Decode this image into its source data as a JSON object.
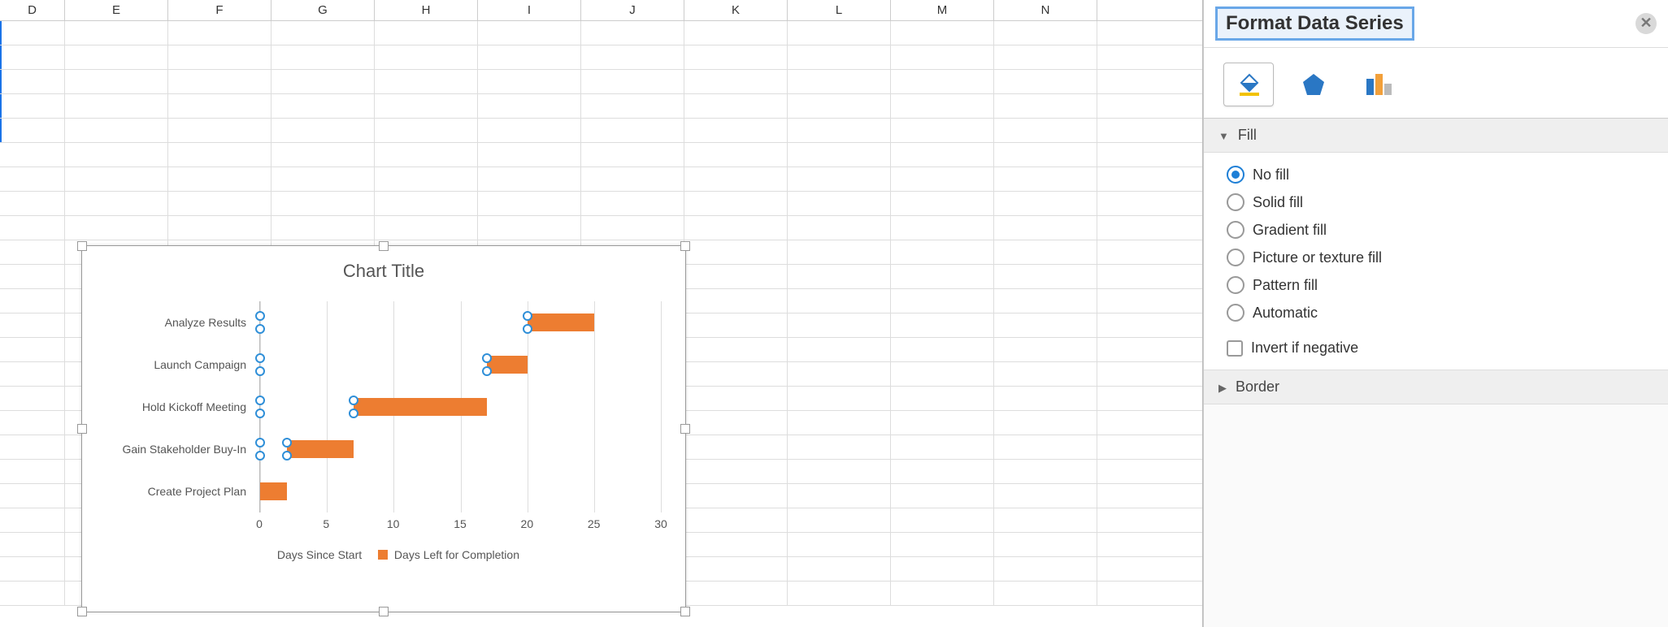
{
  "columns": [
    "D",
    "E",
    "F",
    "G",
    "H",
    "I",
    "J",
    "K",
    "L",
    "M",
    "N"
  ],
  "pane": {
    "title": "Format Data Series",
    "sections": {
      "fill": "Fill",
      "border": "Border"
    },
    "fill_options": {
      "no_fill": "No fill",
      "solid_fill": "Solid fill",
      "gradient_fill": "Gradient fill",
      "picture_fill": "Picture or texture fill",
      "pattern_fill": "Pattern fill",
      "automatic": "Automatic",
      "invert": "Invert if negative"
    },
    "fill_selected": "no_fill"
  },
  "chart_data": {
    "type": "bar",
    "title": "Chart Title",
    "categories": [
      "Analyze Results",
      "Launch Campaign",
      "Hold Kickoff Meeting",
      "Gain Stakeholder Buy-In",
      "Create Project Plan"
    ],
    "series": [
      {
        "name": "Days Since Start",
        "values": [
          20,
          17,
          7,
          2,
          0
        ],
        "color": "transparent",
        "selected": true
      },
      {
        "name": "Days Left for Completion",
        "values": [
          5,
          3,
          10,
          5,
          2
        ],
        "color": "#ed7d31"
      }
    ],
    "xticks": [
      0,
      5,
      10,
      15,
      20,
      25,
      30
    ],
    "xlim": [
      0,
      30
    ],
    "xlabel": "",
    "ylabel": ""
  }
}
